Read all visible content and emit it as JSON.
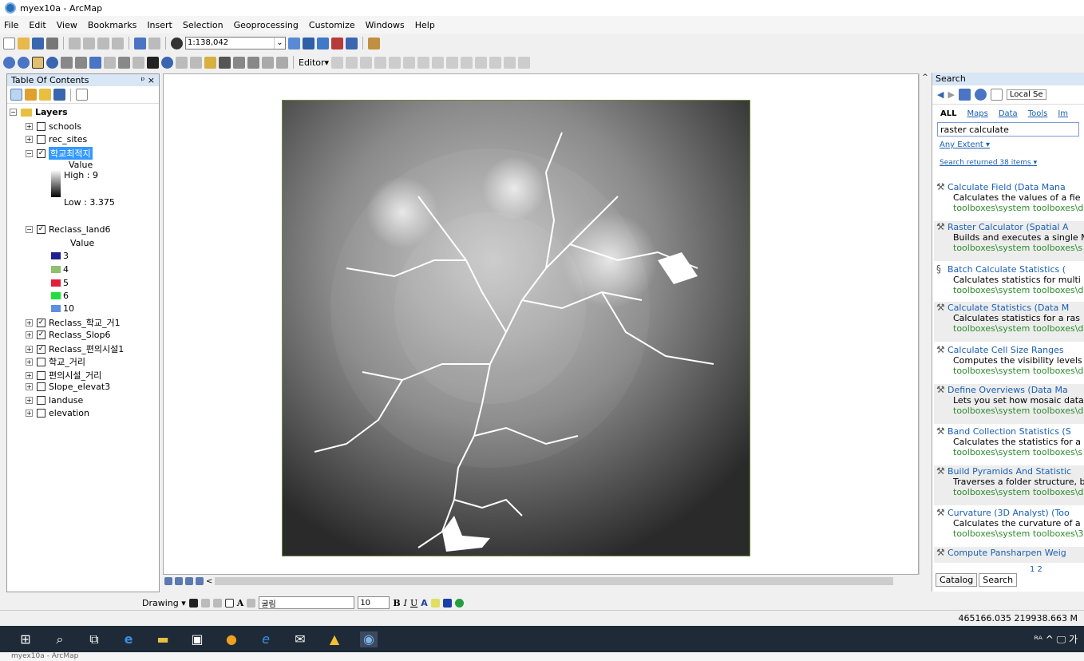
{
  "window": {
    "title": "myex10a - ArcMap"
  },
  "menu": [
    "File",
    "Edit",
    "View",
    "Bookmarks",
    "Insert",
    "Selection",
    "Geoprocessing",
    "Customize",
    "Windows",
    "Help"
  ],
  "toolbar": {
    "scale": "1:138,042",
    "editor_label": "Editor▾"
  },
  "toc": {
    "title": "Table Of Contents",
    "pin_close": "ᵖ ×",
    "root": "Layers",
    "layers": [
      {
        "name": "schools",
        "checked": false
      },
      {
        "name": "rec_sites",
        "checked": false
      },
      {
        "name": "학교최적지",
        "checked": true
      },
      {
        "name": "Reclass_land6",
        "checked": true
      },
      {
        "name": "Reclass_학교_거1",
        "checked": true
      },
      {
        "name": "Reclass_Slop6",
        "checked": true
      },
      {
        "name": "Reclass_편의시설1",
        "checked": true
      },
      {
        "name": "학교_거리",
        "checked": false
      },
      {
        "name": "편의시설_거리",
        "checked": false
      },
      {
        "name": "Slope_elevat3",
        "checked": false
      },
      {
        "name": "landuse",
        "checked": false
      },
      {
        "name": "elevation",
        "checked": false
      }
    ],
    "legend1": {
      "value": "Value",
      "high": "High : 9",
      "low": "Low : 3.375"
    },
    "legend2": {
      "value": "Value",
      "classes": [
        {
          "label": "3",
          "color": "#1f1f8f"
        },
        {
          "label": "4",
          "color": "#8fbf6f"
        },
        {
          "label": "5",
          "color": "#e0203a"
        },
        {
          "label": "6",
          "color": "#1fdf3f"
        },
        {
          "label": "10",
          "color": "#5f8fdf"
        }
      ]
    }
  },
  "search": {
    "title": "Search",
    "local": "Local Se",
    "tabs": [
      "ALL",
      "Maps",
      "Data",
      "Tools",
      "Im"
    ],
    "query": "raster calculate",
    "extent": "Any Extent ▾",
    "returned": "Search returned 38 items ▾",
    "results": [
      {
        "title": "Calculate Field (Data Mana",
        "desc": "Calculates the values of a fie",
        "path": "toolboxes\\system toolboxes\\d"
      },
      {
        "title": "Raster Calculator (Spatial A",
        "desc": "Builds and executes a single M",
        "path": "toolboxes\\system toolboxes\\s"
      },
      {
        "title": "Batch Calculate Statistics (",
        "desc": "Calculates statistics for multi",
        "path": "toolboxes\\system toolboxes\\d"
      },
      {
        "title": "Calculate Statistics (Data M",
        "desc": "Calculates statistics for a ras",
        "path": "toolboxes\\system toolboxes\\d"
      },
      {
        "title": "Calculate Cell Size Ranges",
        "desc": "Computes the visibility levels",
        "path": "toolboxes\\system toolboxes\\d"
      },
      {
        "title": "Define Overviews (Data Ma",
        "desc": "Lets you set how mosaic data",
        "path": "toolboxes\\system toolboxes\\d"
      },
      {
        "title": "Band Collection Statistics (S",
        "desc": "Calculates the statistics for a",
        "path": "toolboxes\\system toolboxes\\s"
      },
      {
        "title": "Build Pyramids And Statistic",
        "desc": "Traverses a folder structure, b",
        "path": "toolboxes\\system toolboxes\\d"
      },
      {
        "title": "Curvature (3D Analyst) (Too",
        "desc": "Calculates the curvature of a",
        "path": "toolboxes\\system toolboxes\\3"
      },
      {
        "title": "Compute Pansharpen Weig",
        "desc": "",
        "path": ""
      }
    ],
    "pages": "1 2",
    "bottom_tabs": [
      "Catalog",
      "Search"
    ]
  },
  "drawing": {
    "label": "Drawing ▾",
    "font": "굴림",
    "size": "10"
  },
  "status": {
    "coords": "465166.035  219938.663 M"
  },
  "bottom_label": "myex10a - ArcMap",
  "taskbar": {
    "tray": "ᴿᴬ  ^ 🖵 가"
  }
}
